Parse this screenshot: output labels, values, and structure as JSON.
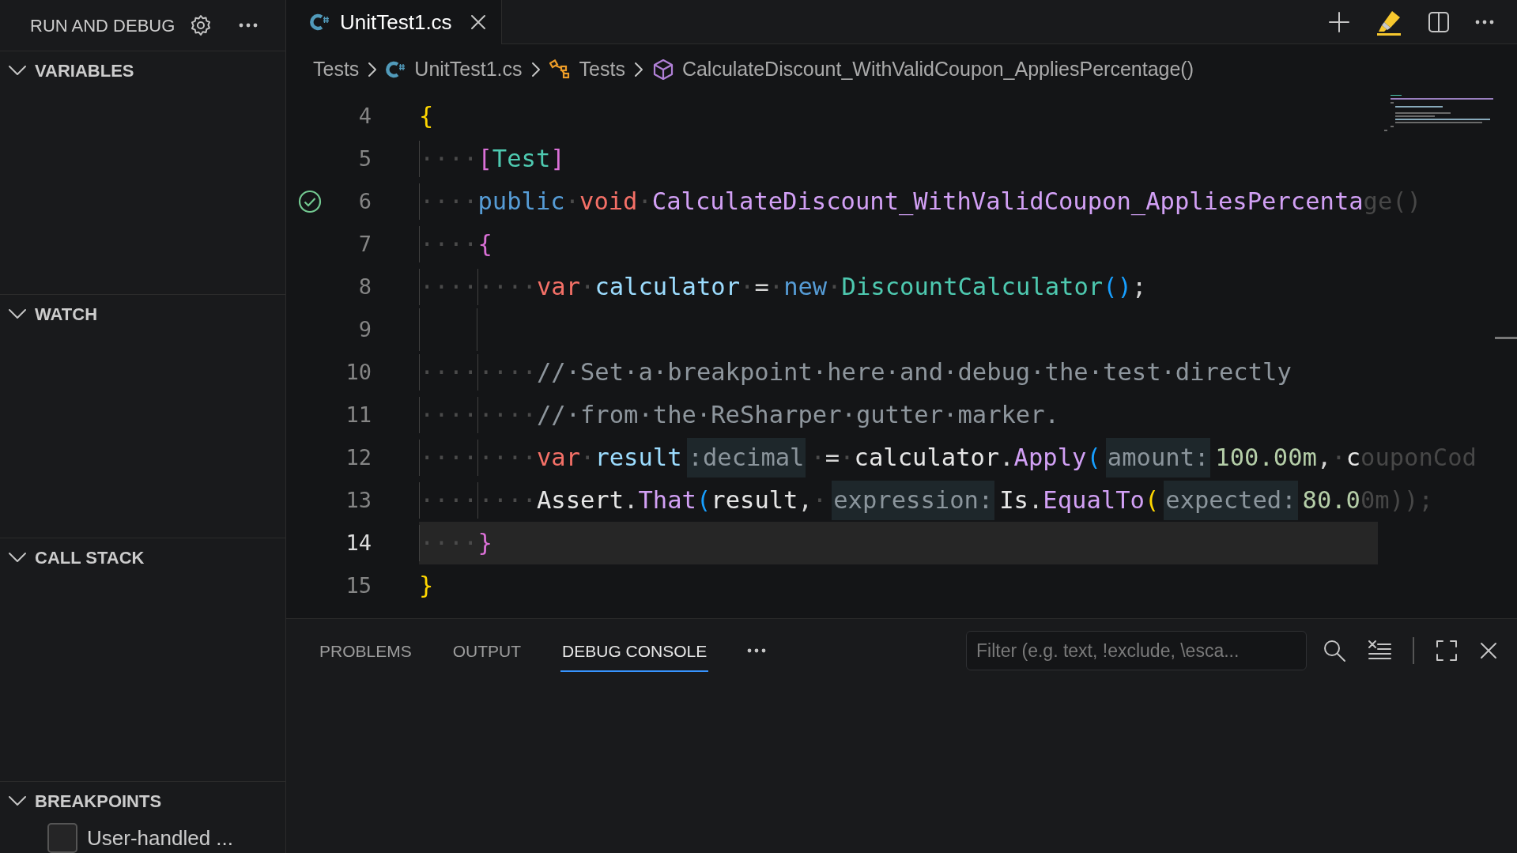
{
  "sidebar": {
    "title": "RUN AND DEBUG",
    "sections": [
      {
        "title": "VARIABLES",
        "expanded": true
      },
      {
        "title": "WATCH",
        "expanded": true
      },
      {
        "title": "CALL STACK",
        "expanded": true
      },
      {
        "title": "BREAKPOINTS",
        "expanded": true,
        "items": [
          {
            "label": "User-handled ...",
            "checked": false
          }
        ]
      }
    ]
  },
  "tabs": [
    {
      "label": "UnitTest1.cs",
      "selected": true
    }
  ],
  "breadcrumbs": [
    {
      "label": "Tests",
      "kind": "folder"
    },
    {
      "label": "UnitTest1.cs",
      "kind": "file"
    },
    {
      "label": "Tests",
      "kind": "class"
    },
    {
      "label": "CalculateDiscount_WithValidCoupon_AppliesPercentage()",
      "kind": "method"
    }
  ],
  "editor": {
    "lines": [
      {
        "number": "4",
        "current": false,
        "test_passed": false,
        "tokens": [
          {
            "kind": "brace",
            "text": "{"
          }
        ]
      },
      {
        "number": "5",
        "current": false,
        "test_passed": false,
        "tokens": [
          {
            "kind": "ws",
            "text": "····"
          },
          {
            "kind": "brace2",
            "text": "["
          },
          {
            "kind": "type",
            "text": "Test"
          },
          {
            "kind": "brace2",
            "text": "]"
          }
        ]
      },
      {
        "number": "6",
        "current": false,
        "test_passed": true,
        "tokens": [
          {
            "kind": "ws",
            "text": "····"
          },
          {
            "kind": "kw",
            "text": "public"
          },
          {
            "kind": "ws",
            "text": "·"
          },
          {
            "kind": "kw2",
            "text": "void"
          },
          {
            "kind": "ws",
            "text": "·"
          },
          {
            "kind": "method",
            "text": "CalculateDiscount_WithValidCoupon_AppliesPercenta"
          },
          {
            "kind": "faded",
            "text": "ge()"
          }
        ]
      },
      {
        "number": "7",
        "current": false,
        "test_passed": false,
        "tokens": [
          {
            "kind": "ws",
            "text": "····"
          },
          {
            "kind": "brace2",
            "text": "{"
          }
        ]
      },
      {
        "number": "8",
        "current": false,
        "test_passed": false,
        "tokens": [
          {
            "kind": "ws",
            "text": "········"
          },
          {
            "kind": "kw2",
            "text": "var"
          },
          {
            "kind": "ws",
            "text": "·"
          },
          {
            "kind": "local",
            "text": "calculator"
          },
          {
            "kind": "ws",
            "text": "·"
          },
          {
            "kind": "op",
            "text": "="
          },
          {
            "kind": "ws",
            "text": "·"
          },
          {
            "kind": "kw",
            "text": "new"
          },
          {
            "kind": "ws",
            "text": "·"
          },
          {
            "kind": "type",
            "text": "DiscountCalculator"
          },
          {
            "kind": "paren",
            "text": "()"
          },
          {
            "kind": "op",
            "text": ";"
          }
        ]
      },
      {
        "number": "9",
        "current": false,
        "test_passed": false
      },
      {
        "number": "10",
        "current": false,
        "test_passed": false,
        "tokens": [
          {
            "kind": "ws",
            "text": "········"
          },
          {
            "kind": "comment",
            "text": "//·Set·a·breakpoint·here·and·debug·the·test·directly"
          }
        ]
      },
      {
        "number": "11",
        "current": false,
        "test_passed": false,
        "tokens": [
          {
            "kind": "ws",
            "text": "········"
          },
          {
            "kind": "comment",
            "text": "//·from·the·ReSharper·gutter·marker."
          }
        ]
      },
      {
        "number": "12",
        "current": false,
        "test_passed": false,
        "tokens": [
          {
            "kind": "ws",
            "text": "········"
          },
          {
            "kind": "kw2",
            "text": "var"
          },
          {
            "kind": "ws",
            "text": "·"
          },
          {
            "kind": "local",
            "text": "result"
          },
          {
            "kind": "hint",
            "text": ":decimal"
          },
          {
            "kind": "ws",
            "text": "·"
          },
          {
            "kind": "op",
            "text": "="
          },
          {
            "kind": "ws",
            "text": "·"
          },
          {
            "kind": "plain",
            "text": "calculator"
          },
          {
            "kind": "op",
            "text": "."
          },
          {
            "kind": "method",
            "text": "Apply"
          },
          {
            "kind": "paren",
            "text": "("
          },
          {
            "kind": "hint",
            "text": "amount:"
          },
          {
            "kind": "num",
            "text": "100.00m"
          },
          {
            "kind": "op",
            "text": ","
          },
          {
            "kind": "ws",
            "text": "·"
          },
          {
            "kind": "plain",
            "text": "c"
          },
          {
            "kind": "faded",
            "text": "ouponCod"
          }
        ]
      },
      {
        "number": "13",
        "current": false,
        "test_passed": false,
        "tokens": [
          {
            "kind": "ws",
            "text": "········"
          },
          {
            "kind": "plain",
            "text": "Assert"
          },
          {
            "kind": "op",
            "text": "."
          },
          {
            "kind": "method",
            "text": "That"
          },
          {
            "kind": "paren",
            "text": "("
          },
          {
            "kind": "plain",
            "text": "result"
          },
          {
            "kind": "op",
            "text": ","
          },
          {
            "kind": "ws",
            "text": "·"
          },
          {
            "kind": "hint",
            "text": "expression:"
          },
          {
            "kind": "plain",
            "text": "Is"
          },
          {
            "kind": "op",
            "text": "."
          },
          {
            "kind": "method",
            "text": "EqualTo"
          },
          {
            "kind": "paren2",
            "text": "("
          },
          {
            "kind": "hint",
            "text": "expected:"
          },
          {
            "kind": "num",
            "text": "80.0"
          },
          {
            "kind": "faded",
            "text": "0m));"
          }
        ]
      },
      {
        "number": "14",
        "current": true,
        "test_passed": false,
        "tokens": [
          {
            "kind": "ws",
            "text": "····"
          },
          {
            "kind": "brace2",
            "text": "}"
          }
        ]
      },
      {
        "number": "15",
        "current": false,
        "test_passed": false,
        "tokens": [
          {
            "kind": "brace",
            "text": "}"
          }
        ]
      }
    ]
  },
  "panel": {
    "tabs": [
      {
        "label": "PROBLEMS",
        "selected": false
      },
      {
        "label": "OUTPUT",
        "selected": false
      },
      {
        "label": "DEBUG CONSOLE",
        "selected": true
      }
    ],
    "filter": {
      "placeholder": "Filter (e.g. text, !exclude, \\esca..."
    }
  }
}
